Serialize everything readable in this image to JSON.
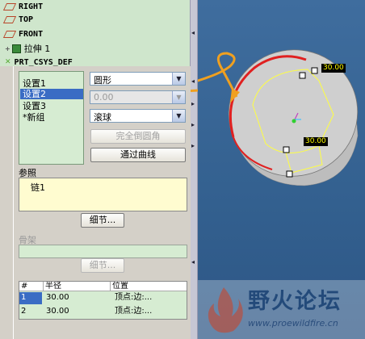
{
  "model_tree": {
    "items": [
      {
        "label": "RIGHT",
        "icon": "datum-plane-icon"
      },
      {
        "label": "TOP",
        "icon": "datum-plane-icon"
      },
      {
        "label": "FRONT",
        "icon": "datum-plane-icon"
      },
      {
        "label": "拉伸 1",
        "icon": "extrude-icon"
      },
      {
        "label": "PRT_CSYS_DEF",
        "icon": "csys-icon"
      }
    ]
  },
  "round_dialog": {
    "sets": [
      "设置1",
      "设置2",
      "设置3",
      "*新组"
    ],
    "selected_set": "设置2",
    "shape_value": "圆形",
    "dim_value": "0.00",
    "method_value": "滚球",
    "full_round_label": "完全倒圆角",
    "through_curve_label": "通过曲线",
    "references_label": "参照",
    "reference_item": "链1",
    "details_label": "细节...",
    "skeleton_label": "骨架",
    "details2_label": "细节...",
    "table": {
      "headers": [
        "#",
        "半径",
        "位置"
      ],
      "rows": [
        {
          "num": "1",
          "radius": "30.00",
          "location": "顶点:边:..."
        },
        {
          "num": "2",
          "radius": "30.00",
          "location": "顶点:边:..."
        }
      ]
    }
  },
  "graphics": {
    "dim_labels": [
      "30.00",
      "30.00"
    ],
    "watermark_title": "野火论坛",
    "watermark_url": "www.proewildfire.cn",
    "colors": {
      "background": "#3a6797",
      "highlight": "#e02020",
      "preview": "#ffff40",
      "arrow": "#f0a020"
    }
  }
}
